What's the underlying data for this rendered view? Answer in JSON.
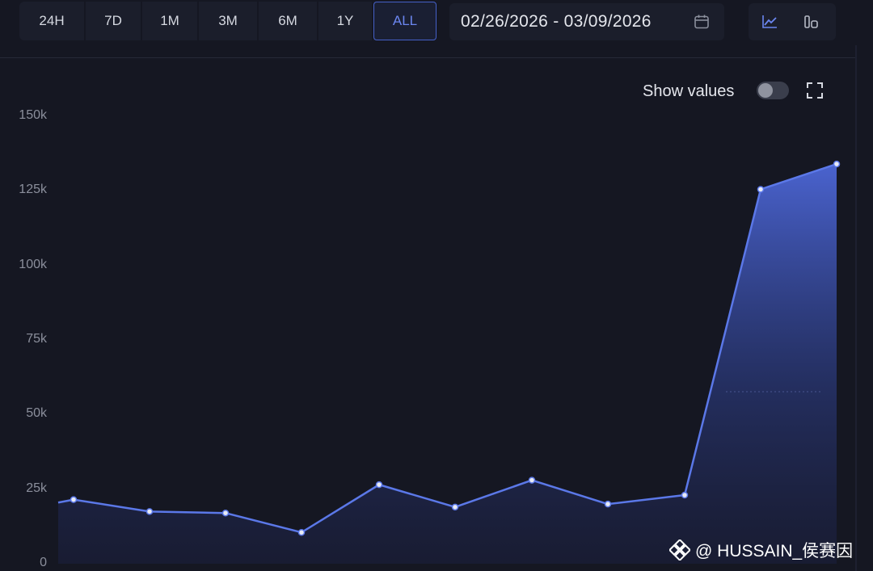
{
  "toolbar": {
    "ranges": [
      "24H",
      "7D",
      "1M",
      "3M",
      "6M",
      "1Y",
      "ALL"
    ],
    "active_range": "ALL",
    "date_range": "02/26/2026 - 03/09/2026",
    "view_modes": [
      "line-chart-icon",
      "bar-chart-icon"
    ],
    "active_view": "line-chart-icon"
  },
  "controls": {
    "show_values_label": "Show values",
    "show_values_on": false
  },
  "chart_data": {
    "type": "area",
    "title": "",
    "xlabel": "",
    "ylabel": "",
    "ylim": [
      0,
      150000
    ],
    "y_ticks": [
      "0",
      "25k",
      "50k",
      "75k",
      "100k",
      "125k",
      "150k"
    ],
    "y_tick_values": [
      0,
      25000,
      50000,
      75000,
      100000,
      125000,
      150000
    ],
    "x": [
      0,
      1,
      2,
      3,
      4,
      5,
      6,
      7,
      8,
      9,
      10,
      11
    ],
    "values": [
      21500,
      17500,
      17000,
      10500,
      26500,
      19000,
      28000,
      20000,
      23000,
      125500,
      134000
    ],
    "first_point_value": 20500,
    "grid": false,
    "color": "#5b78e8"
  },
  "watermark": {
    "text": "@ HUSSAIN_侯赛因"
  }
}
